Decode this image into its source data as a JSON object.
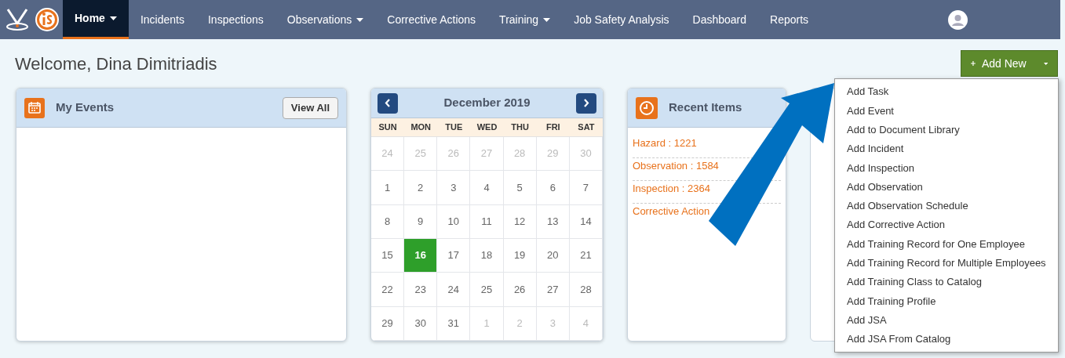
{
  "nav": {
    "items": [
      {
        "label": "Home",
        "selected": true,
        "has_menu": true
      },
      {
        "label": "Incidents",
        "selected": false,
        "has_menu": false
      },
      {
        "label": "Inspections",
        "selected": false,
        "has_menu": false
      },
      {
        "label": "Observations",
        "selected": false,
        "has_menu": true
      },
      {
        "label": "Corrective Actions",
        "selected": false,
        "has_menu": false
      },
      {
        "label": "Training",
        "selected": false,
        "has_menu": true
      },
      {
        "label": "Job Safety Analysis",
        "selected": false,
        "has_menu": false
      },
      {
        "label": "Dashboard",
        "selected": false,
        "has_menu": false
      },
      {
        "label": "Reports",
        "selected": false,
        "has_menu": false
      }
    ]
  },
  "welcome": "Welcome, Dina Dimitriadis",
  "add_new": {
    "label": "Add New",
    "menu": [
      "Add Task",
      "Add Event",
      "Add to Document Library",
      "Add Incident",
      "Add Inspection",
      "Add Observation",
      "Add Observation Schedule",
      "Add Corrective Action",
      "Add Training Record for One Employee",
      "Add Training Record for Multiple Employees",
      "Add Training Class to Catalog",
      "Add Training Profile",
      "Add JSA",
      "Add JSA From Catalog"
    ]
  },
  "my_events": {
    "title": "My Events",
    "button": "View All"
  },
  "calendar": {
    "title": "December 2019",
    "weekdays": [
      "SUN",
      "MON",
      "TUE",
      "WED",
      "THU",
      "FRI",
      "SAT"
    ],
    "weeks": [
      [
        {
          "day": "24",
          "in_month": false,
          "selected": false
        },
        {
          "day": "25",
          "in_month": false,
          "selected": false
        },
        {
          "day": "26",
          "in_month": false,
          "selected": false
        },
        {
          "day": "27",
          "in_month": false,
          "selected": false
        },
        {
          "day": "28",
          "in_month": false,
          "selected": false
        },
        {
          "day": "29",
          "in_month": false,
          "selected": false
        },
        {
          "day": "30",
          "in_month": false,
          "selected": false
        }
      ],
      [
        {
          "day": "1",
          "in_month": true,
          "selected": false
        },
        {
          "day": "2",
          "in_month": true,
          "selected": false
        },
        {
          "day": "3",
          "in_month": true,
          "selected": false
        },
        {
          "day": "4",
          "in_month": true,
          "selected": false
        },
        {
          "day": "5",
          "in_month": true,
          "selected": false
        },
        {
          "day": "6",
          "in_month": true,
          "selected": false
        },
        {
          "day": "7",
          "in_month": true,
          "selected": false
        }
      ],
      [
        {
          "day": "8",
          "in_month": true,
          "selected": false
        },
        {
          "day": "9",
          "in_month": true,
          "selected": false
        },
        {
          "day": "10",
          "in_month": true,
          "selected": false
        },
        {
          "day": "11",
          "in_month": true,
          "selected": false
        },
        {
          "day": "12",
          "in_month": true,
          "selected": false
        },
        {
          "day": "13",
          "in_month": true,
          "selected": false
        },
        {
          "day": "14",
          "in_month": true,
          "selected": false
        }
      ],
      [
        {
          "day": "15",
          "in_month": true,
          "selected": false
        },
        {
          "day": "16",
          "in_month": true,
          "selected": true
        },
        {
          "day": "17",
          "in_month": true,
          "selected": false
        },
        {
          "day": "18",
          "in_month": true,
          "selected": false
        },
        {
          "day": "19",
          "in_month": true,
          "selected": false
        },
        {
          "day": "20",
          "in_month": true,
          "selected": false
        },
        {
          "day": "21",
          "in_month": true,
          "selected": false
        }
      ],
      [
        {
          "day": "22",
          "in_month": true,
          "selected": false
        },
        {
          "day": "23",
          "in_month": true,
          "selected": false
        },
        {
          "day": "24",
          "in_month": true,
          "selected": false
        },
        {
          "day": "25",
          "in_month": true,
          "selected": false
        },
        {
          "day": "26",
          "in_month": true,
          "selected": false
        },
        {
          "day": "27",
          "in_month": true,
          "selected": false
        },
        {
          "day": "28",
          "in_month": true,
          "selected": false
        }
      ],
      [
        {
          "day": "29",
          "in_month": true,
          "selected": false
        },
        {
          "day": "30",
          "in_month": true,
          "selected": false
        },
        {
          "day": "31",
          "in_month": true,
          "selected": false
        },
        {
          "day": "1",
          "in_month": false,
          "selected": false
        },
        {
          "day": "2",
          "in_month": false,
          "selected": false
        },
        {
          "day": "3",
          "in_month": false,
          "selected": false
        },
        {
          "day": "4",
          "in_month": false,
          "selected": false
        }
      ]
    ]
  },
  "recent_items": {
    "title": "Recent Items",
    "items": [
      "Hazard : 1221",
      "Observation : 1584",
      "Inspection : 2364",
      "Corrective Action"
    ]
  }
}
